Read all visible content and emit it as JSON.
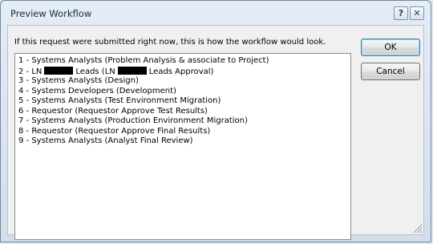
{
  "window": {
    "title": "Preview Workflow",
    "help_label": "?",
    "close_label": "✕"
  },
  "instruction": "If this request were submitted right now, this is how the workflow would look.",
  "workflow_steps": [
    {
      "before": "1 - Systems Analysts (Problem Analysis & associate to Project)"
    },
    {
      "before": "2 - LN",
      "middle": "Leads (LN",
      "after": "Leads Approval)",
      "redacted": true
    },
    {
      "before": "3 - Systems Analysts (Design)"
    },
    {
      "before": "4 - Systems Developers (Development)"
    },
    {
      "before": "5 - Systems Analysts (Test Environment Migration)"
    },
    {
      "before": "6 - Requestor (Requestor Approve Test Results)"
    },
    {
      "before": "7 - Systems Analysts (Production Environment Migration)"
    },
    {
      "before": "8 - Requestor (Requestor Approve Final Results)"
    },
    {
      "before": "9 - Systems Analysts (Analyst Final Review)"
    }
  ],
  "buttons": {
    "ok_label": "OK",
    "cancel_label": "Cancel"
  }
}
